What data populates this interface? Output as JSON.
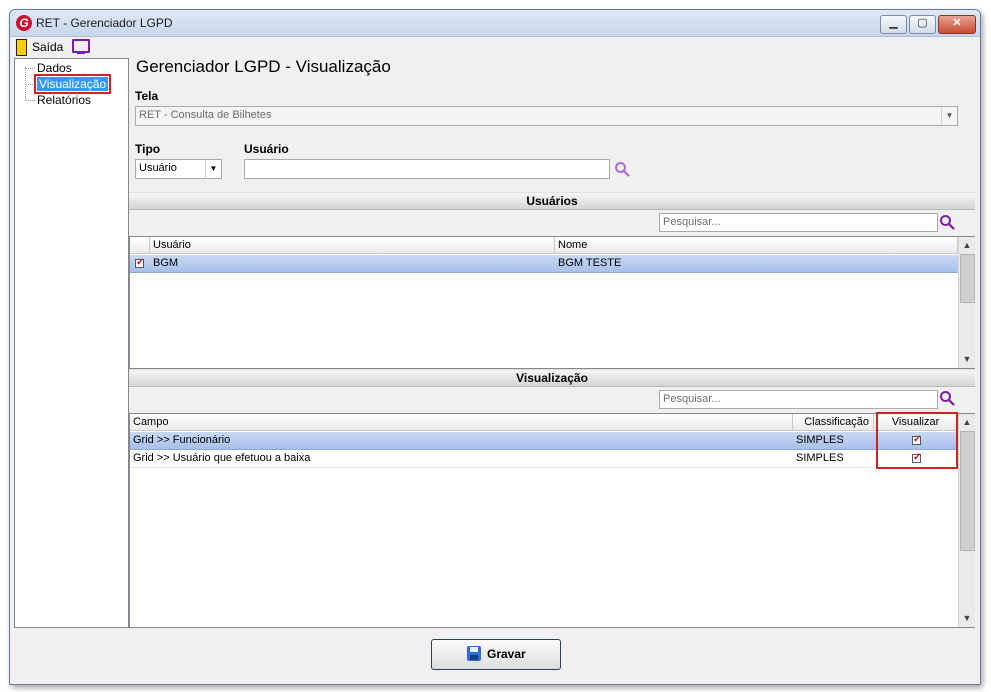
{
  "window": {
    "title": "RET - Gerenciador LGPD",
    "app_icon_letter": "G",
    "minimize": "▁",
    "maximize": "▢",
    "close": "✕"
  },
  "toolbar": {
    "exit_label": "Saída"
  },
  "tree": {
    "items": [
      {
        "label": "Dados",
        "selected": false
      },
      {
        "label": "Visualização",
        "selected": true
      },
      {
        "label": "Relatórios",
        "selected": false
      }
    ]
  },
  "main": {
    "title": "Gerenciador LGPD - Visualização",
    "tela_label": "Tela",
    "tela_value": "RET - Consulta de Bilhetes",
    "tipo_label": "Tipo",
    "tipo_value": "Usuário",
    "usuario_label": "Usuário",
    "usuario_value": ""
  },
  "users_section": {
    "header": "Usuários",
    "search_placeholder": "Pesquisar...",
    "columns": [
      "Usuário",
      "Nome"
    ],
    "rows": [
      {
        "checked": true,
        "usuario": "BGM",
        "nome": "BGM TESTE"
      }
    ]
  },
  "view_section": {
    "header": "Visualização",
    "search_placeholder": "Pesquisar...",
    "columns": [
      "Campo",
      "Classificação",
      "Visualizar"
    ],
    "rows": [
      {
        "campo": "Grid >> Funcionário",
        "classificacao": "SIMPLES",
        "visualizar": true
      },
      {
        "campo": "Grid >> Usuário que efetuou a baixa",
        "classificacao": "SIMPLES",
        "visualizar": true
      }
    ]
  },
  "footer": {
    "save_label": "Gravar"
  },
  "colors": {
    "accent": "#3399ff",
    "highlight_red": "#d42020",
    "monitor": "#7c1ea8",
    "search_icon": "#7c1ea8"
  }
}
